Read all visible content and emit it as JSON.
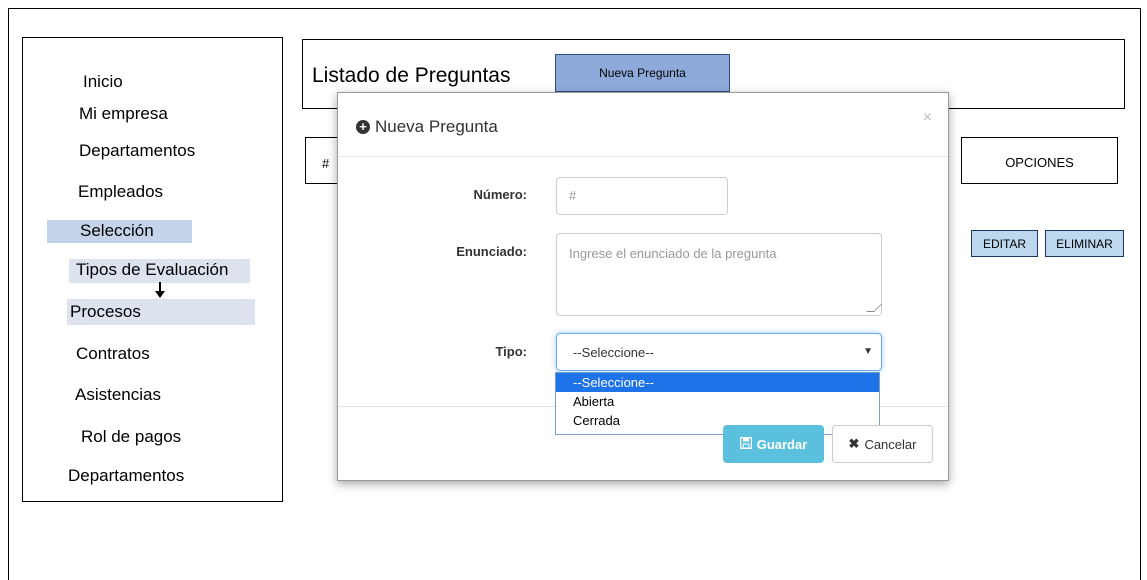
{
  "sidebar": {
    "items": [
      {
        "label": "Inicio"
      },
      {
        "label": "Mi empresa"
      },
      {
        "label": "Departamentos"
      },
      {
        "label": "Empleados"
      },
      {
        "label": "Selección"
      },
      {
        "label": "Tipos de Evaluación"
      },
      {
        "label": "Procesos"
      },
      {
        "label": "Contratos"
      },
      {
        "label": "Asistencias"
      },
      {
        "label": "Rol de pagos"
      },
      {
        "label": "Departamentos"
      }
    ]
  },
  "header": {
    "title": "Listado de Preguntas",
    "new_button": "Nueva Pregunta"
  },
  "table": {
    "col_hash": "#",
    "col_options": "OPCIONES",
    "edit_button": "EDITAR",
    "delete_button": "ELIMINAR"
  },
  "modal": {
    "title": "Nueva Pregunta",
    "close": "×",
    "numero_label": "Número:",
    "numero_placeholder": "#",
    "enunciado_label": "Enunciado:",
    "enunciado_placeholder": "Ingrese el enunciado de la pregunta",
    "tipo_label": "Tipo:",
    "tipo_value": "--Seleccione--",
    "tipo_options": [
      "--Seleccione--",
      "Abierta",
      "Cerrada"
    ],
    "save_button": "Guardar",
    "cancel_button": "Cancelar"
  },
  "colors": {
    "new_button_bg": "#8eaadb",
    "row_button_bg": "#bdd7ee",
    "save_bg": "#5bc0de",
    "option_selected_bg": "#1e73e8"
  }
}
